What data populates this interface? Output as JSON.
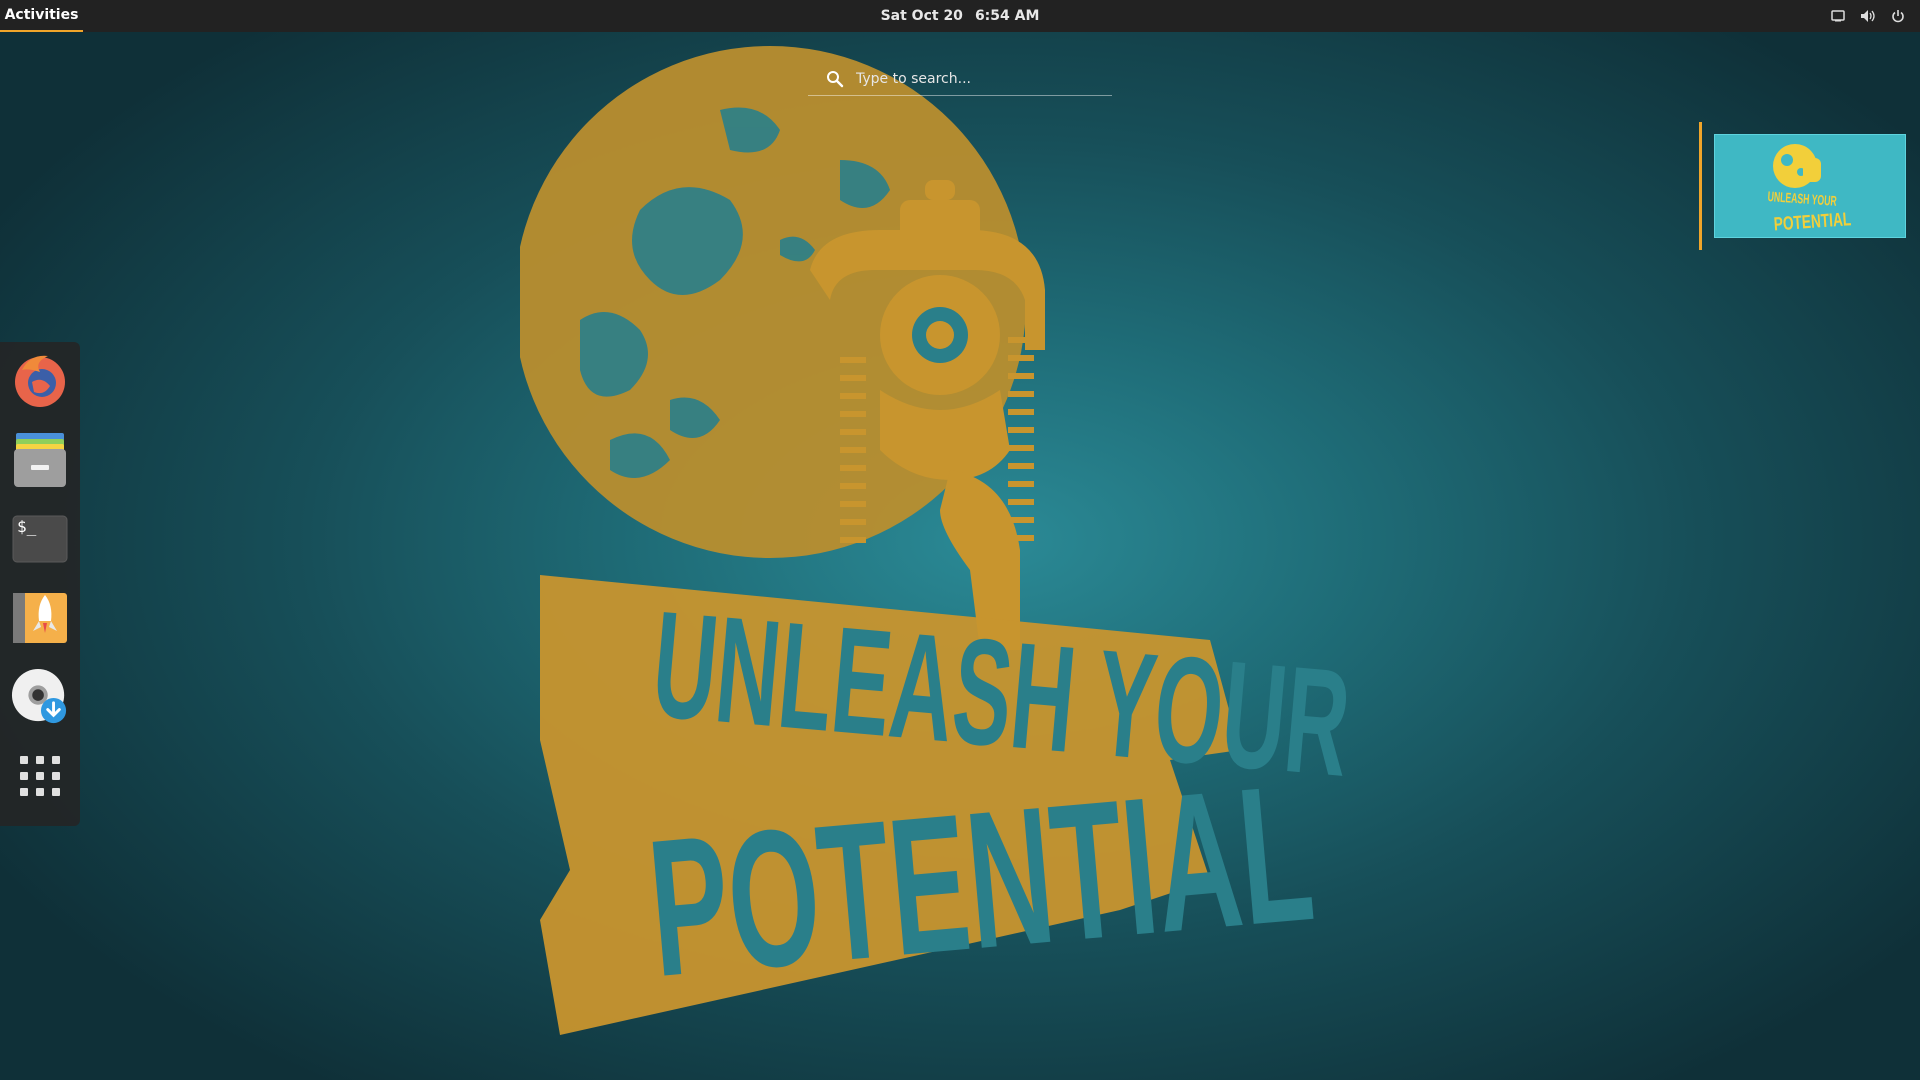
{
  "topbar": {
    "activities_label": "Activities",
    "date": "Sat Oct 20",
    "time": "6:54 AM"
  },
  "search": {
    "placeholder": "Type to search..."
  },
  "dash": {
    "items": [
      {
        "name": "Firefox",
        "icon": "firefox-icon"
      },
      {
        "name": "Files",
        "icon": "files-icon"
      },
      {
        "name": "Terminal",
        "icon": "terminal-icon"
      },
      {
        "name": "Launcher",
        "icon": "rocket-icon"
      },
      {
        "name": "Software Installer",
        "icon": "disc-download-icon"
      },
      {
        "name": "Show Applications",
        "icon": "app-grid-icon"
      }
    ],
    "terminal_prompt": "$_"
  },
  "wallpaper": {
    "line1": "UNLEASH YOUR",
    "line2": "POTENTIAL"
  },
  "colors": {
    "accent": "#f0a52a",
    "gold": "#c8952e",
    "teal": "#2b8a96",
    "topbar": "#222222"
  }
}
